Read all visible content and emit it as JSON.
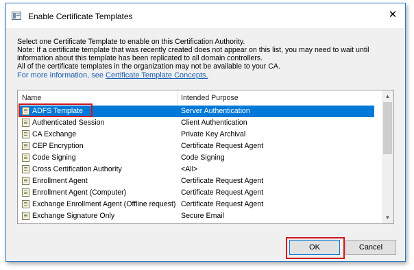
{
  "window": {
    "title": "Enable Certificate Templates",
    "close_glyph": "✕"
  },
  "intro": {
    "line1": "Select one Certificate Template to enable on this Certification Authority.",
    "line2": "Note: If a certificate template that was recently created does not appear on this list, you may need to wait until",
    "line3": "information about this template has been replicated to all domain controllers.",
    "line4": "All of the certificate templates in the organization may not be available to your CA.",
    "more_prefix": "For more information, see ",
    "more_link": "Certificate Template Concepts."
  },
  "list": {
    "columns": {
      "name": "Name",
      "purpose": "Intended Purpose"
    },
    "rows": [
      {
        "name": "ADFS Template",
        "purpose": "Server Authentication",
        "selected": true
      },
      {
        "name": "Authenticated Session",
        "purpose": "Client Authentication"
      },
      {
        "name": "CA Exchange",
        "purpose": "Private Key Archival"
      },
      {
        "name": "CEP Encryption",
        "purpose": "Certificate Request Agent"
      },
      {
        "name": "Code Signing",
        "purpose": "Code Signing"
      },
      {
        "name": "Cross Certification Authority",
        "purpose": "<All>"
      },
      {
        "name": "Enrollment Agent",
        "purpose": "Certificate Request Agent"
      },
      {
        "name": "Enrollment Agent (Computer)",
        "purpose": "Certificate Request Agent"
      },
      {
        "name": "Exchange Enrollment Agent (Offline request)",
        "purpose": "Certificate Request Agent"
      },
      {
        "name": "Exchange Signature Only",
        "purpose": "Secure Email"
      }
    ],
    "scroll_up_glyph": "▲",
    "scroll_down_glyph": "▼"
  },
  "buttons": {
    "ok": "OK",
    "cancel": "Cancel"
  },
  "colors": {
    "selection": "#0078d7",
    "highlight": "#d0161d",
    "link": "#1a5fb4"
  }
}
